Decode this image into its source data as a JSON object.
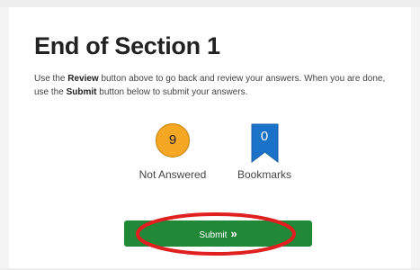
{
  "section": {
    "title": "End of Section 1",
    "instructions": {
      "part1": "Use the ",
      "review_label": "Review",
      "part2": " button above to go back and review your answers. When you are done, use the ",
      "submit_label": "Submit",
      "part3": " button below to submit your answers."
    }
  },
  "summary": {
    "not_answered": {
      "count": "9",
      "label": "Not Answered",
      "color": "#f5a623"
    },
    "bookmarks": {
      "count": "0",
      "label": "Bookmarks",
      "color": "#1a73c9"
    }
  },
  "submit_button": {
    "label": "Submit",
    "icon": "double-chevron-right-icon",
    "color": "#218838"
  },
  "annotation": {
    "highlight_color": "#e02020"
  }
}
